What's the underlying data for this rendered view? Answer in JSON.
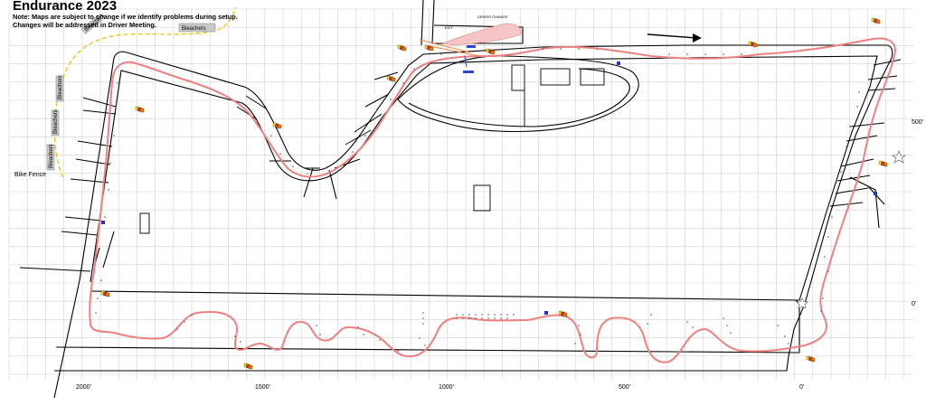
{
  "map": {
    "title": "Endurance 2023",
    "note_line1": "Note: Maps are subject to change if we identify problems during setup.",
    "note_line2": "Changes will be addressed in Driver Meeting.",
    "x_axis_labels": [
      "2000'",
      "1500'",
      "1000'",
      "500'",
      "0'"
    ],
    "y_axis_labels": [
      "500'",
      "0'"
    ],
    "bleachers_label": "Bleachers",
    "bike_fence_label": "Bike Fence",
    "driver_change_label": "DRIVER CHANGE",
    "exit_label": "EXIT",
    "course_color": "#f08080",
    "road_color": "#000000",
    "grid_color": "#c8c8c8",
    "bleachers_fence_color": "#f2c200",
    "cone_color": "#555555",
    "direction": "clockwise arrow pointing east along top straight",
    "icons": [
      "flag-station-icon",
      "checkered-flag-icon",
      "blue-flag-icon",
      "star-icon"
    ]
  }
}
